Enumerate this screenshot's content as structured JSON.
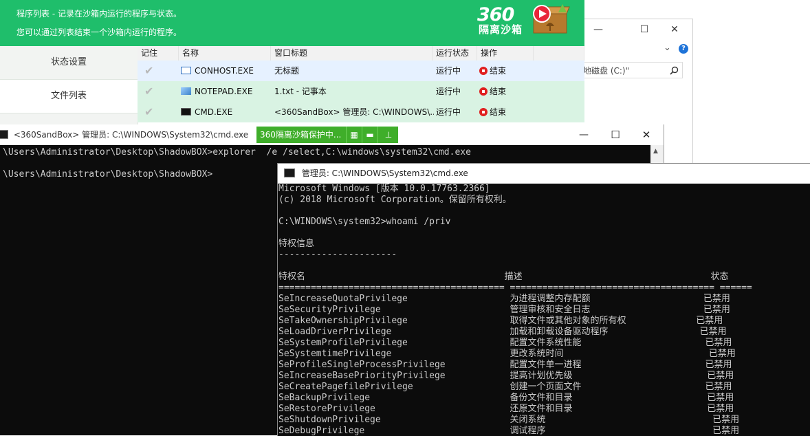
{
  "explorer": {
    "search_text": "地磁盘 (C:)\"",
    "minimize": "—",
    "maximize": "☐",
    "close": "✕",
    "help": "?",
    "chevron": "⌄"
  },
  "sandbox": {
    "header_line1": "程序列表 - 记录在沙箱内运行的程序与状态。",
    "header_line2": "您可以通过列表结束一个沙箱内运行的程序。",
    "logo_number": "360",
    "logo_text": "隔离沙箱",
    "side_items": [
      "状态设置",
      "文件列表"
    ],
    "columns": [
      "记住",
      "名称",
      "窗口标题",
      "运行状态",
      "操作"
    ],
    "rows": [
      {
        "name": "CONHOST.EXE",
        "title": "无标题",
        "status": "运行中",
        "action": "结束"
      },
      {
        "name": "NOTEPAD.EXE",
        "title": "1.txt - 记事本",
        "status": "运行中",
        "action": "结束"
      },
      {
        "name": "CMD.EXE",
        "title": "<360SandBox> 管理员: C:\\WINDOWS\\...",
        "status": "运行中",
        "action": "结束"
      }
    ]
  },
  "cmd1": {
    "title": "<360SandBox> 管理员: C:\\WINDOWS\\System32\\cmd.exe",
    "badge": "360隔离沙箱保护中...",
    "lines": [
      "\\Users\\Administrator\\Desktop\\ShadowBOX>explorer  /e /select,C:\\windows\\system32\\cmd.exe",
      "",
      "\\Users\\Administrator\\Desktop\\ShadowBOX>"
    ]
  },
  "cmd2": {
    "title": "管理员: C:\\WINDOWS\\System32\\cmd.exe",
    "lines": [
      "Microsoft Windows [版本 10.0.17763.2366]",
      "(c) 2018 Microsoft Corporation。保留所有权利。",
      "",
      "C:\\WINDOWS\\system32>whoami /priv",
      "",
      "特权信息",
      "----------------------",
      "",
      "特权名                                     描述                                   状态",
      "========================================== ====================================== ======",
      "SeIncreaseQuotaPrivilege                   为进程调整内存配额                     已禁用",
      "SeSecurityPrivilege                        管理审核和安全日志                     已禁用",
      "SeTakeOwnershipPrivilege                   取得文件或其他对象的所有权             已禁用",
      "SeLoadDriverPrivilege                      加载和卸载设备驱动程序                 已禁用",
      "SeSystemProfilePrivilege                   配置文件系统性能                       已禁用",
      "SeSystemtimePrivilege                      更改系统时间                           已禁用",
      "SeProfileSingleProcessPrivilege            配置文件单一进程                       已禁用",
      "SeIncreaseBasePriorityPrivilege            提高计划优先级                         已禁用",
      "SeCreatePagefilePrivilege                  创建一个页面文件                       已禁用",
      "SeBackupPrivilege                          备份文件和目录                         已禁用",
      "SeRestorePrivilege                         还原文件和目录                         已禁用",
      "SeShutdownPrivilege                        关闭系统                               已禁用",
      "SeDebugPrivilege                           调试程序                               已禁用"
    ]
  },
  "colors": {
    "sandbox_green": "#1fbe6b",
    "console_bg": "#0c0c0c",
    "console_fg": "#cccccc",
    "stop_red": "#e02020"
  }
}
